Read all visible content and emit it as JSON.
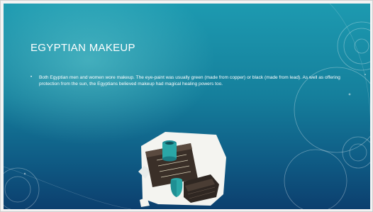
{
  "slide": {
    "title": "EGYPTIAN MAKEUP",
    "bullets": [
      "Both Egyptian men and women wore makeup. The eye-paint was usually green (made from copper) or black (made from lead). As well as offering protection from the sun, the Egyptians believed makeup had magical healing powers too."
    ],
    "bullet_symbol": "•",
    "image": {
      "icon": "cosmetic-box-photo",
      "description_colors": {
        "box": "#3a2f28",
        "jar": "#2aa7a7",
        "paper": "#f4f4f0"
      }
    }
  },
  "colors": {
    "background_top": "#1d9ab0",
    "background_bottom": "#0c3f6e",
    "text": "#ffffff",
    "frame_border": "#cfcfcf"
  }
}
